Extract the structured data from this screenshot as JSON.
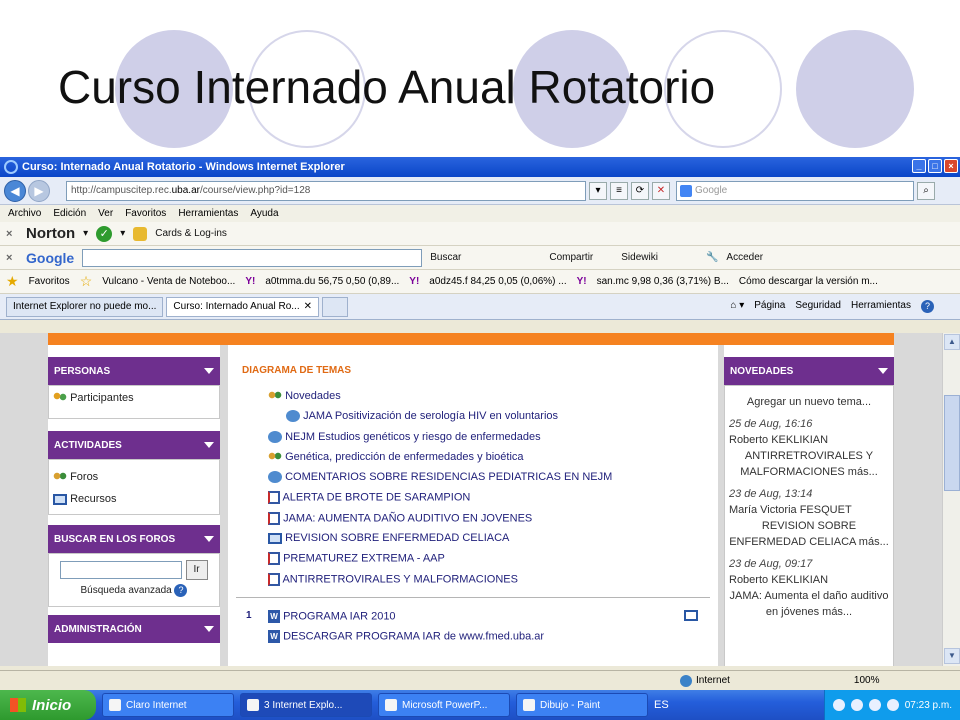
{
  "slide": {
    "title": "Curso Internado Anual Rotatorio"
  },
  "window": {
    "title": "Curso: Internado Anual Rotatorio - Windows Internet Explorer",
    "url_prefix": "http://campuscitep.rec.",
    "url_host": "uba.ar",
    "url_suffix": "/course/view.php?id=128",
    "search_placeholder": "Google"
  },
  "menu": [
    "Archivo",
    "Edición",
    "Ver",
    "Favoritos",
    "Herramientas",
    "Ayuda"
  ],
  "norton_toolbar": {
    "brand": "Norton",
    "cards_label": "Cards & Log-ins"
  },
  "google_toolbar": {
    "brand": "Google",
    "buscar": "Buscar",
    "compartir": "Compartir",
    "sidewiki": "Sidewiki",
    "acceder": "Acceder"
  },
  "favorites": {
    "label": "Favoritos",
    "items": [
      "Vulcano - Venta de Noteboo...",
      "a0tmma.du 56,75 0,50 (0,89...",
      "a0dz45.f 84,25 0,05 (0,06%) ...",
      "san.mc 9,98 0,36 (3,71%)  B...",
      "Cómo descargar la versión m..."
    ]
  },
  "tabs": {
    "tab1": "Internet Explorer no puede mo...",
    "tab2": "Curso: Internado Anual Ro...",
    "pagina": "Página",
    "seguridad": "Seguridad",
    "herramientas": "Herramientas"
  },
  "blocks": {
    "personas": {
      "title": "PERSONAS",
      "participantes": "Participantes"
    },
    "actividades": {
      "title": "ACTIVIDADES",
      "foros": "Foros",
      "recursos": "Recursos"
    },
    "buscar": {
      "title": "BUSCAR EN LOS FOROS",
      "button": "Ir",
      "advanced": "Búsqueda avanzada"
    },
    "admin": {
      "title": "ADMINISTRACIÓN"
    }
  },
  "main": {
    "title": "DIAGRAMA DE TEMAS",
    "topics": [
      "Novedades",
      "JAMA Positivización de serología HIV en voluntarios",
      "NEJM Estudios genéticos y riesgo de enfermedades",
      "Genética, predicción de enfermedades y bioética",
      "COMENTARIOS SOBRE RESIDENCIAS PEDIATRICAS EN NEJM",
      "ALERTA DE BROTE DE SARAMPION",
      "JAMA: AUMENTA DAÑO AUDITIVO EN JOVENES",
      "REVISION SOBRE ENFERMEDAD CELIACA",
      "PREMATUREZ EXTREMA - AAP",
      "ANTIRRETROVIRALES Y MALFORMACIONES"
    ],
    "section1_number": "1",
    "section1_items": [
      "PROGRAMA IAR 2010",
      "DESCARGAR PROGRAMA IAR de www.fmed.uba.ar"
    ]
  },
  "novedades": {
    "title": "NOVEDADES",
    "add": "Agregar un nuevo tema...",
    "posts": [
      {
        "date": "25 de Aug, 16:16",
        "author": "Roberto KEKLIKIAN",
        "text": "ANTIRRETROVIRALES Y MALFORMACIONES más..."
      },
      {
        "date": "23 de Aug, 13:14",
        "author": "María Victoria FESQUET",
        "text": "REVISION SOBRE ENFERMEDAD CELIACA más..."
      },
      {
        "date": "23 de Aug, 09:17",
        "author": "Roberto KEKLIKIAN",
        "text": "JAMA: Aumenta el daño auditivo en jóvenes más..."
      }
    ]
  },
  "status": {
    "zone": "Internet",
    "zoom": "100%"
  },
  "taskbar": {
    "start": "Inicio",
    "tasks": [
      "Claro Internet",
      "3 Internet Explo...",
      "Microsoft PowerP...",
      "Dibujo - Paint"
    ],
    "lang": "ES",
    "clock": "07:23 p.m."
  }
}
